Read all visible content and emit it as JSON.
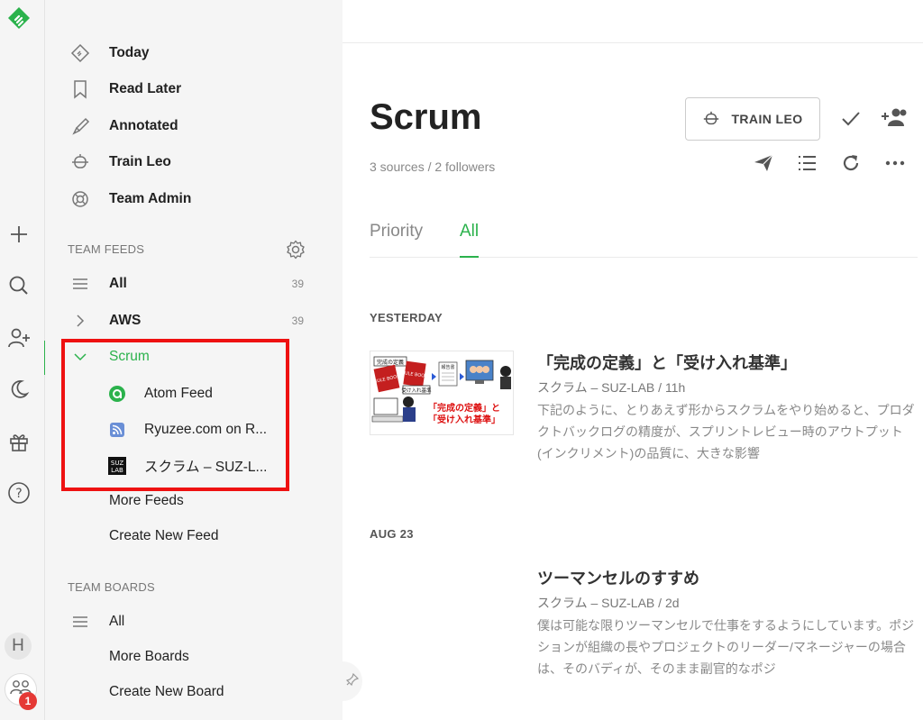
{
  "colors": {
    "accent": "#2bb24c",
    "highlight_box": "#ee1111",
    "badge": "#e53935"
  },
  "rail": {
    "avatar_letter": "H",
    "team_badge": "1",
    "icons": [
      "feedly-logo-icon",
      "plus-icon",
      "search-icon",
      "add-person-icon",
      "moon-icon",
      "gift-icon",
      "help-icon",
      "team-icon"
    ]
  },
  "sidebar": {
    "nav": [
      {
        "label": "Today",
        "icon": "today-icon"
      },
      {
        "label": "Read Later",
        "icon": "bookmark-icon"
      },
      {
        "label": "Annotated",
        "icon": "highlighter-icon"
      },
      {
        "label": "Train Leo",
        "icon": "leo-icon"
      },
      {
        "label": "Team Admin",
        "icon": "lifebuoy-icon"
      }
    ],
    "team_feeds": {
      "title": "TEAM FEEDS",
      "items": [
        {
          "label": "All",
          "count": "39"
        },
        {
          "label": "AWS",
          "count": "39"
        },
        {
          "label": "Scrum"
        }
      ],
      "sources": [
        {
          "label": "Atom Feed",
          "icon": "atom-feed-icon"
        },
        {
          "label": "Ryuzee.com on R...",
          "icon": "rss-icon"
        },
        {
          "label": "スクラム – SUZ-L...",
          "icon": "suz-lab-icon",
          "icon_text": "SUZ LAB"
        }
      ],
      "more": "More Feeds",
      "create": "Create New Feed"
    },
    "team_boards": {
      "title": "TEAM BOARDS",
      "all": "All",
      "more": "More Boards",
      "create": "Create New Board"
    }
  },
  "main": {
    "title": "Scrum",
    "subtitle": "3 sources / 2 followers",
    "train_button": "TRAIN LEO",
    "tabs": [
      {
        "label": "Priority"
      },
      {
        "label": "All"
      }
    ],
    "active_tab": "All",
    "sections": [
      {
        "day": "YESTERDAY",
        "article": {
          "title": "「完成の定義」と「受け入れ基準」",
          "meta": "スクラム – SUZ-LAB / 11h",
          "summary": "下記のように、とりあえず形からスクラムをやり始めると、プロダクトバックログの精度が、スプリントレビュー時のアウトプット(インクリメント)の品質に、大きな影響",
          "thumb": {
            "tag_top": "完成の定義",
            "tag_bottom": "受け入れ基準",
            "book": "RULE BOOK",
            "doc": "報告書",
            "caption_1": "「完成の定義」と",
            "caption_2": "「受け入れ基準」"
          }
        }
      },
      {
        "day": "AUG 23",
        "article": {
          "title": "ツーマンセルのすすめ",
          "meta": "スクラム – SUZ-LAB / 2d",
          "summary": "僕は可能な限りツーマンセルで仕事をするようにしています。ポジションが組織の長やプロジェクトのリーダー/マネージャーの場合は、そのバディが、そのまま副官的なポジ"
        }
      }
    ]
  }
}
